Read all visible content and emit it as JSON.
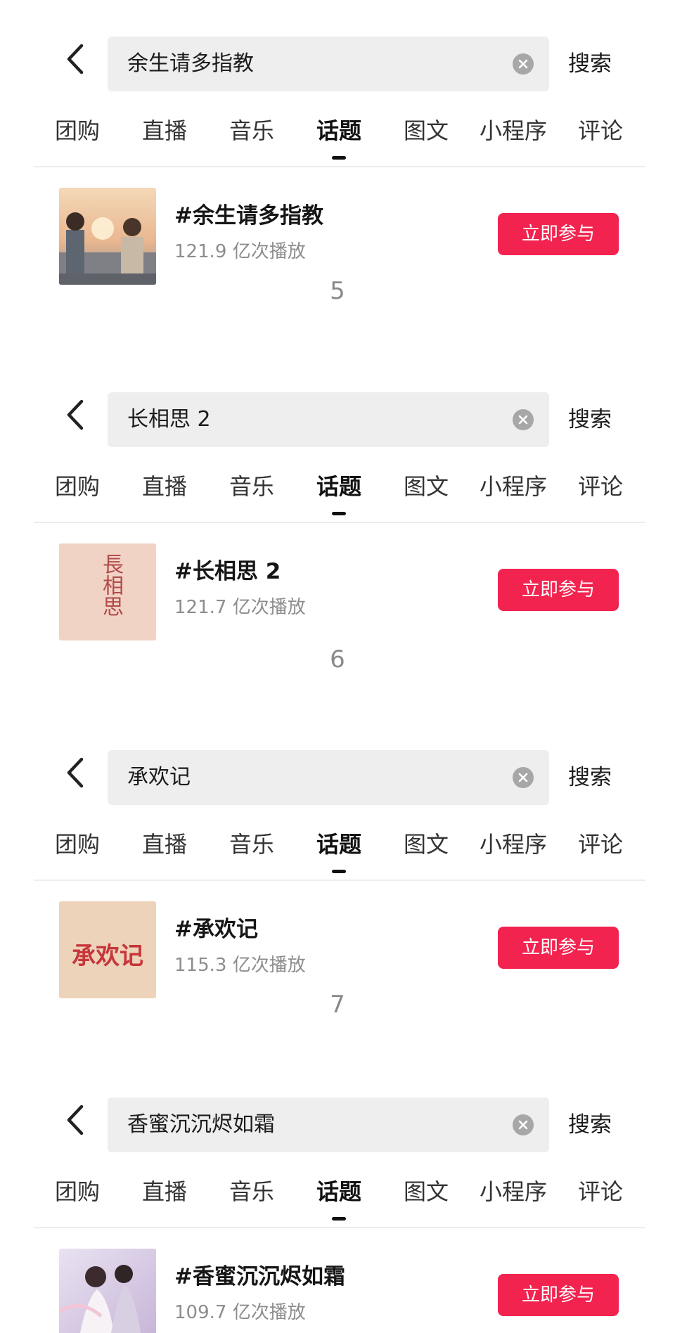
{
  "search_label": "搜索",
  "tabs": [
    "团购",
    "直播",
    "音乐",
    "话题",
    "图文",
    "小程序",
    "评论"
  ],
  "active_tab": "话题",
  "join_label": "立即参与",
  "icons": {
    "back": "chevron-left-icon",
    "clear": "clear-circle-icon"
  },
  "colors": {
    "accent": "#f2234f",
    "search_bg": "#eeeeee",
    "muted_text": "#8d8d8d"
  },
  "blocks": [
    {
      "query": "余生请多指教",
      "topic": "#余生请多指教",
      "plays": "121.9 亿次播放",
      "thumb_text": "",
      "rank_after": "5"
    },
    {
      "query": "长相思 2",
      "topic": "#长相思 2",
      "plays": "121.7 亿次播放",
      "thumb_text": "長相思",
      "rank_after": "6"
    },
    {
      "query": "承欢记",
      "topic": "#承欢记",
      "plays": "115.3 亿次播放",
      "thumb_text": "承欢记",
      "rank_after": "7"
    },
    {
      "query": "香蜜沉沉烬如霜",
      "topic": "#香蜜沉沉烬如霜",
      "plays": "109.7 亿次播放",
      "thumb_text": "",
      "rank_after": ""
    }
  ]
}
